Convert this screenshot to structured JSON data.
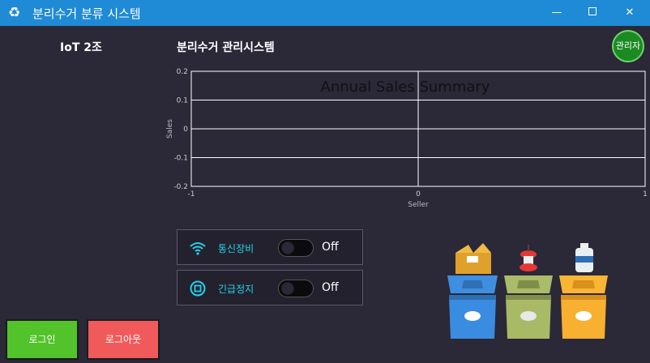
{
  "window": {
    "title": "분리수거 분류 시스템",
    "icon": "recycle-icon",
    "minimize": "—",
    "close": "✕"
  },
  "header": {
    "team": "IoT 2조",
    "system_title": "분리수거 관리시스템",
    "admin_button": "관리자"
  },
  "chart_data": {
    "type": "line",
    "title": "Annual Sales Summary",
    "xlabel": "Seller",
    "ylabel": "Sales",
    "xlim": [
      -1,
      1
    ],
    "ylim": [
      -0.2,
      0.2
    ],
    "x_ticks": [
      "-1",
      "0",
      "1"
    ],
    "y_ticks": [
      "0.2",
      "0.1",
      "0",
      "-0.1",
      "-0.2"
    ],
    "grid": true,
    "series": []
  },
  "controls": [
    {
      "label": "통신장비",
      "icon": "wifi-icon",
      "state": "Off"
    },
    {
      "label": "긴급정지",
      "icon": "stop-icon",
      "state": "Off"
    }
  ],
  "buttons": {
    "login": "로그인",
    "logout": "로그아웃"
  },
  "colors": {
    "titlebar": "#1f8ad6",
    "background": "#2b2838",
    "accent_cyan": "#21d3e8",
    "login": "#52c32a",
    "logout": "#f15a5a",
    "admin": "#1b8a22"
  }
}
